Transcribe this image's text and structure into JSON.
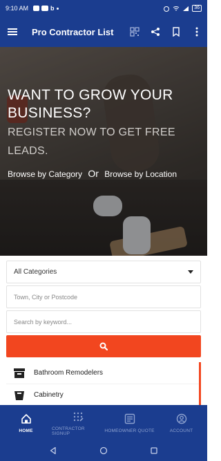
{
  "status_bar": {
    "time": "9:10 AM",
    "battery": "36"
  },
  "app_bar": {
    "title": "Pro Contractor List",
    "icons": [
      "menu-icon",
      "qr-code-icon",
      "share-icon",
      "bookmark-icon",
      "more-vert-icon"
    ]
  },
  "hero": {
    "headline": "WANT TO GROW YOUR BUSINESS?",
    "subheadline": "REGISTER NOW TO GET FREE LEADS.",
    "browse_category": "Browse by Category",
    "or": "Or",
    "browse_location": "Browse by Location"
  },
  "search": {
    "category_selected": "All Categories",
    "location_placeholder": "Town, City or Postcode",
    "keyword_placeholder": "Search by keyword...",
    "button_icon": "search-icon"
  },
  "categories": [
    {
      "label": "Bathroom Remodelers",
      "icon": "box-icon"
    },
    {
      "label": "Cabinetry",
      "icon": "cabinet-icon"
    }
  ],
  "bottom_nav": [
    {
      "label": "HOME",
      "icon": "home-icon",
      "active": true
    },
    {
      "label": "CONTRACTOR SIGNUP",
      "icon": "keypad-icon",
      "active": false
    },
    {
      "label": "HOMEOWNER QUOTE",
      "icon": "form-icon",
      "active": false
    },
    {
      "label": "ACCOUNT",
      "icon": "account-icon",
      "active": false
    }
  ],
  "colors": {
    "primary": "#1b3d8f",
    "accent": "#f2461f"
  }
}
